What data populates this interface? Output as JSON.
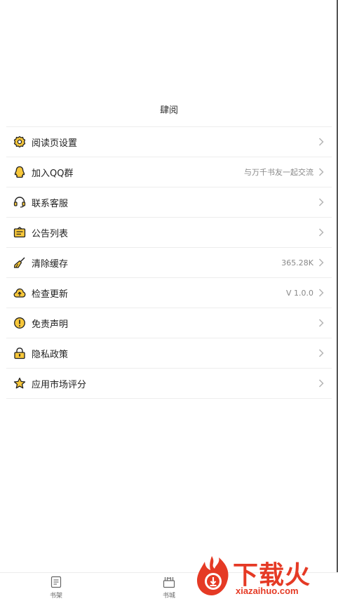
{
  "header": {
    "title": "肆阅"
  },
  "menu": {
    "items": [
      {
        "label": "阅读页设置",
        "value": "",
        "icon": "gear-icon"
      },
      {
        "label": "加入QQ群",
        "value": "与万千书友一起交流",
        "icon": "qq-penguin-icon"
      },
      {
        "label": "联系客服",
        "value": "",
        "icon": "headset-icon"
      },
      {
        "label": "公告列表",
        "value": "",
        "icon": "notice-board-icon"
      },
      {
        "label": "清除缓存",
        "value": "365.28K",
        "icon": "broom-icon"
      },
      {
        "label": "检查更新",
        "value": "V 1.0.0",
        "icon": "cloud-upload-icon"
      },
      {
        "label": "免责声明",
        "value": "",
        "icon": "exclamation-circle-icon"
      },
      {
        "label": "隐私政策",
        "value": "",
        "icon": "lock-icon"
      },
      {
        "label": "应用市场评分",
        "value": "",
        "icon": "star-icon"
      }
    ]
  },
  "tabbar": {
    "tabs": [
      {
        "label": "书架",
        "icon": "bookshelf-icon"
      },
      {
        "label": "书城",
        "icon": "bookstore-icon"
      }
    ]
  },
  "watermark": {
    "text": "下载火",
    "url": "xiazaihuo.com"
  },
  "colors": {
    "accent": "#F7C73A",
    "icon_stroke": "#222222",
    "watermark": "#E53A25"
  }
}
